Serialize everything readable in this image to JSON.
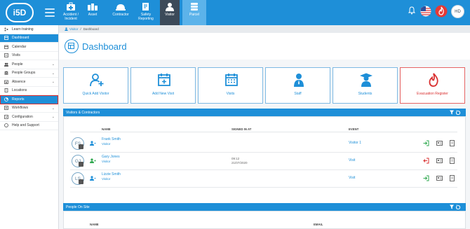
{
  "app": {
    "logo": "i5D"
  },
  "modules": [
    {
      "label": "Accident / Incident"
    },
    {
      "label": "Asset"
    },
    {
      "label": "Contractor"
    },
    {
      "label": "Safety Reporting"
    },
    {
      "label": "Visitor"
    },
    {
      "label": "Parcel"
    }
  ],
  "user": {
    "initials": "HD"
  },
  "sidebar": {
    "items": [
      {
        "label": "Learn training"
      },
      {
        "label": "Dashboard"
      },
      {
        "label": "Calendar"
      },
      {
        "label": "Visits"
      },
      {
        "label": "People"
      },
      {
        "label": "People Groups"
      },
      {
        "label": "Absence"
      },
      {
        "label": "Locations"
      },
      {
        "label": "Reports"
      },
      {
        "label": "Workflows"
      },
      {
        "label": "Configuration"
      },
      {
        "label": "Help and Support"
      }
    ]
  },
  "breadcrumb": {
    "root": "Visitor",
    "separator": "/",
    "current": "Dashboard"
  },
  "page": {
    "title": "Dashboard"
  },
  "tiles": [
    {
      "label": "Quick Add Visitor"
    },
    {
      "label": "Add New Visit"
    },
    {
      "label": "Visits"
    },
    {
      "label": "Staff"
    },
    {
      "label": "Students"
    },
    {
      "label": "Evacuation Register"
    }
  ],
  "visitors_panel": {
    "title": "Visitors & Contractors",
    "headers": {
      "name": "NAME",
      "signed_in_at": "SIGNED IN AT",
      "event": "EVENT"
    },
    "rows": [
      {
        "initials": "FS",
        "name": "Frank Smith",
        "type": "Visitor",
        "signed_time": "",
        "signed_date": "",
        "event": "Visitor 1",
        "status": "in"
      },
      {
        "initials": "GJ",
        "name": "Gary Jones",
        "type": "Visitor",
        "signed_time": "09:12",
        "signed_date": "21/07/2020",
        "event": "Visit",
        "status": "out"
      },
      {
        "initials": "LS",
        "name": "Lizzie Smith",
        "type": "Visitor",
        "signed_time": "",
        "signed_date": "",
        "event": "Visit",
        "status": "in"
      }
    ]
  },
  "people_panel": {
    "title": "People On Site",
    "headers": {
      "name": "NAME",
      "email": "EMAIL"
    }
  },
  "colors": {
    "primary": "#1e8fd8",
    "danger": "#d93030",
    "nav_dark": "#3c4a59"
  }
}
